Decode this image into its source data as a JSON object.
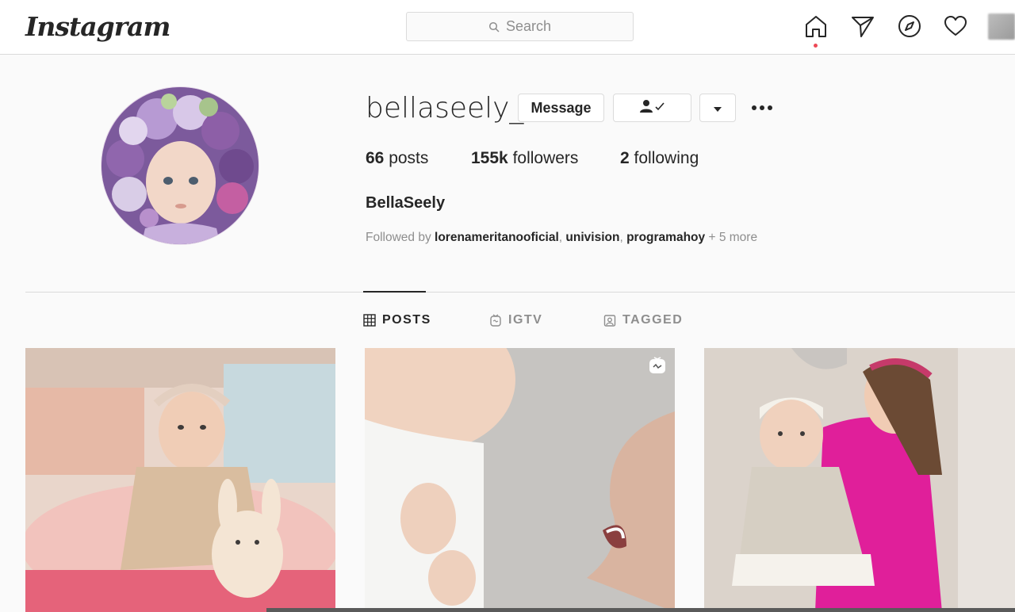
{
  "header": {
    "logo_text": "Instagram",
    "search_placeholder": "Search",
    "icons": [
      "home-icon",
      "direct-icon",
      "explore-icon",
      "activity-icon"
    ],
    "notification_color": "#ed4956"
  },
  "profile": {
    "username": "bellaseely_",
    "full_name": "BellaSeely",
    "message_label": "Message",
    "following_button_icon": "user-check-icon",
    "dropdown_icon": "caret-down-icon",
    "more_icon": "more-options-icon",
    "stats": {
      "posts_value": "66",
      "posts_label": "posts",
      "followers_value": "155k",
      "followers_label": "followers",
      "following_value": "2",
      "following_label": "following"
    },
    "followed_by": {
      "prefix": "Followed by",
      "accounts": [
        "lorenameritanooficial",
        "univision",
        "programahoy"
      ],
      "suffix": "+ 5 more"
    }
  },
  "tabs": [
    {
      "label": "POSTS",
      "icon": "grid-icon",
      "active": true
    },
    {
      "label": "IGTV",
      "icon": "igtv-icon",
      "active": false
    },
    {
      "label": "TAGGED",
      "icon": "tagged-icon",
      "active": false
    }
  ],
  "posts": [
    {
      "type": "photo"
    },
    {
      "type": "igtv",
      "badge_icon": "igtv-badge-icon"
    },
    {
      "type": "photo"
    }
  ],
  "colors": {
    "text_primary": "#262626",
    "text_secondary": "#8e8e8e",
    "border": "#dbdbdb",
    "background": "#fafafa"
  }
}
